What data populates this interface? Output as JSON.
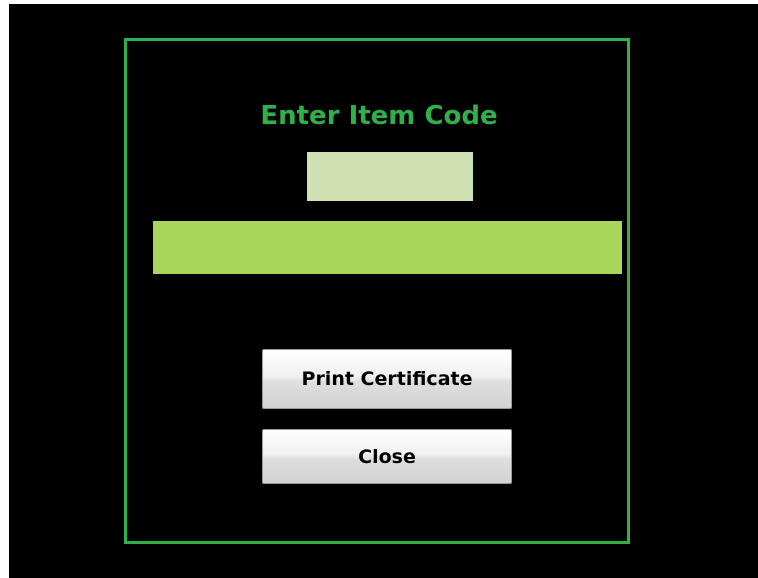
{
  "form": {
    "title": "Enter Item Code",
    "item_code": {
      "value": "",
      "placeholder": ""
    },
    "result_text": ""
  },
  "buttons": {
    "print_label": "Print Certificate",
    "close_label": "Close"
  },
  "colors": {
    "background": "#000000",
    "frame_border": "#2eb04a",
    "title": "#2eb04a",
    "input_fill": "#cfe0b3",
    "result_bar_fill": "#a8d65a",
    "button_face": "#e6e6e6"
  }
}
